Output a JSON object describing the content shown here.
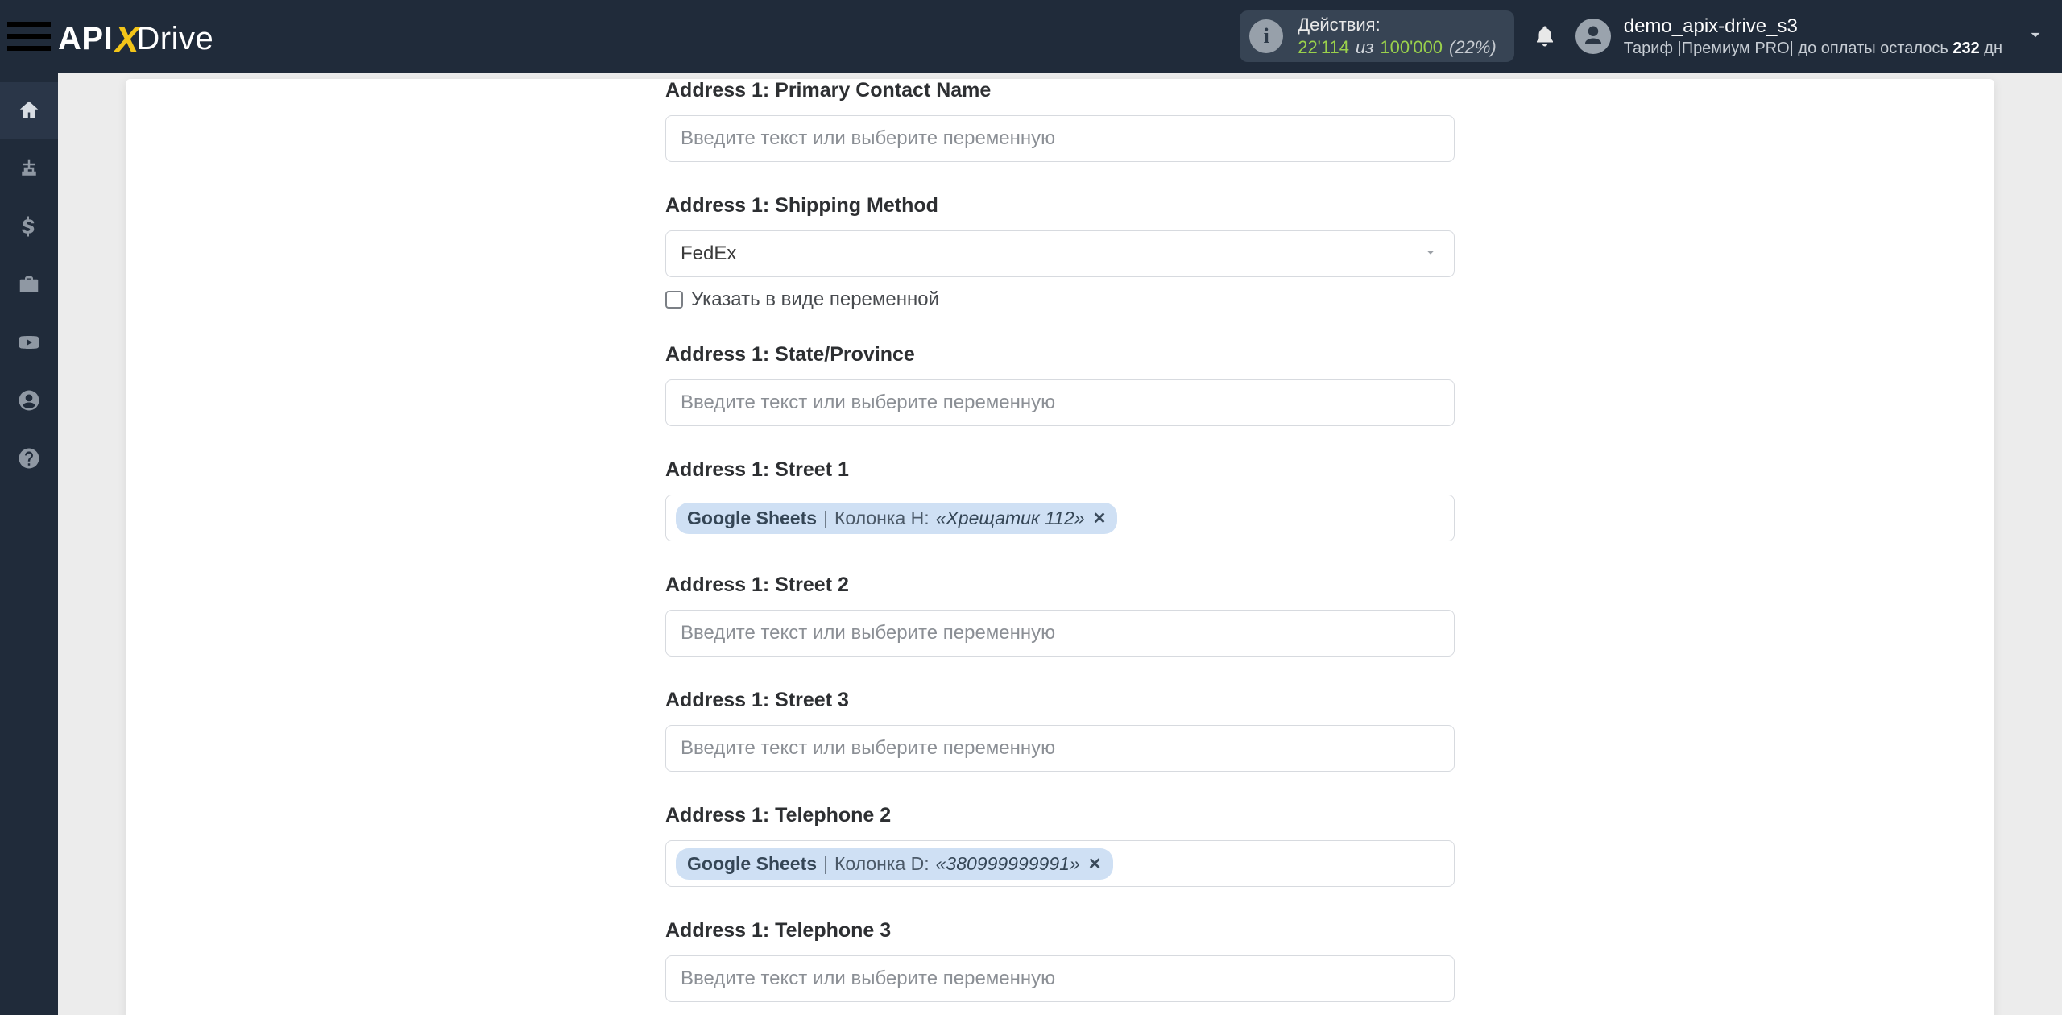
{
  "header": {
    "logo": {
      "a": "API",
      "x": "X",
      "d": "Drive"
    },
    "actions": {
      "label": "Действия:",
      "current": "22'114",
      "iz": "из",
      "max": "100'000",
      "pct": "(22%)"
    },
    "user": {
      "name": "demo_apix-drive_s3",
      "tariff_prefix": "Тариф |",
      "tariff_name": "Премиум PRO",
      "tariff_sep": "| до оплаты осталось ",
      "days": "232",
      "days_suffix": " дн"
    }
  },
  "sidebar": {
    "items": [
      "home",
      "sitemap",
      "dollar",
      "briefcase",
      "youtube",
      "user",
      "help"
    ]
  },
  "form": {
    "placeholder": "Введите текст или выберите переменную",
    "checkbox_label": "Указать в виде переменной",
    "groups": [
      {
        "id": "primary-contact",
        "label": "Address 1: Primary Contact Name",
        "type": "text"
      },
      {
        "id": "shipping-method",
        "label": "Address 1: Shipping Method",
        "type": "select",
        "value": "FedEx",
        "checkbox": true
      },
      {
        "id": "state",
        "label": "Address 1: State/Province",
        "type": "text"
      },
      {
        "id": "street1",
        "label": "Address 1: Street 1",
        "type": "tag",
        "tag": {
          "source": "Google Sheets",
          "column": "Колонка H:",
          "sample": "«Хрещатик 112»"
        }
      },
      {
        "id": "street2",
        "label": "Address 1: Street 2",
        "type": "text"
      },
      {
        "id": "street3",
        "label": "Address 1: Street 3",
        "type": "text"
      },
      {
        "id": "tel2",
        "label": "Address 1: Telephone 2",
        "type": "tag",
        "tag": {
          "source": "Google Sheets",
          "column": "Колонка D:",
          "sample": "«380999999991»"
        }
      },
      {
        "id": "tel3",
        "label": "Address 1: Telephone 3",
        "type": "text"
      }
    ]
  }
}
